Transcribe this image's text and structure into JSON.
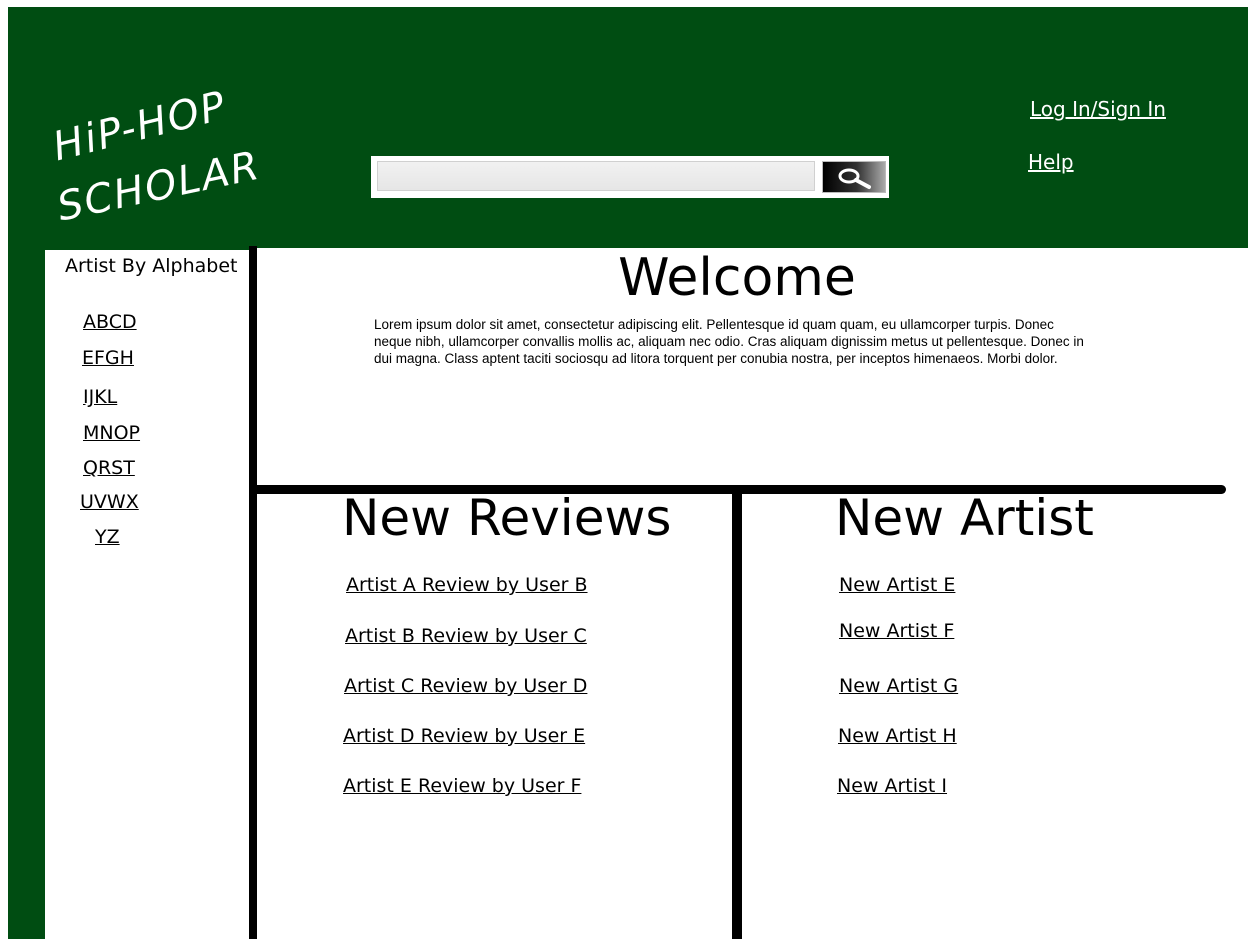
{
  "header": {
    "logo_line1": "HiP-HOP",
    "logo_line2": "SCHOLAR",
    "login_label": "Log In/Sign In",
    "help_label": "Help",
    "search": {
      "value": "",
      "placeholder": ""
    }
  },
  "sidebar": {
    "title": "Artist By Alphabet",
    "items": [
      "ABCD",
      "EFGH",
      "IJKL",
      "MNOP",
      "QRST",
      "UVWX",
      "YZ"
    ]
  },
  "welcome": {
    "title": "Welcome",
    "body": "Lorem ipsum dolor sit amet, consectetur adipiscing elit. Pellentesque id quam quam, eu ullamcorper turpis. Donec neque nibh, ullamcorper convallis mollis ac, aliquam nec odio. Cras aliquam dignissim metus ut pellentesque. Donec in dui magna. Class aptent taciti sociosqu ad litora torquent per conubia nostra, per inceptos himenaeos. Morbi dolor."
  },
  "reviews": {
    "title": "New Reviews",
    "items": [
      "Artist A Review by User B",
      "Artist B Review by User C",
      "Artist C Review by User D",
      "Artist D Review by User E",
      "Artist E Review by User F"
    ]
  },
  "artists": {
    "title": "New Artist",
    "items": [
      "New Artist E",
      "New Artist F",
      "New Artist G",
      "New Artist H",
      "New Artist I"
    ]
  },
  "colors": {
    "brand_green": "#004d12",
    "divider": "#000000"
  },
  "icons": {
    "search": "magnifier-icon"
  }
}
